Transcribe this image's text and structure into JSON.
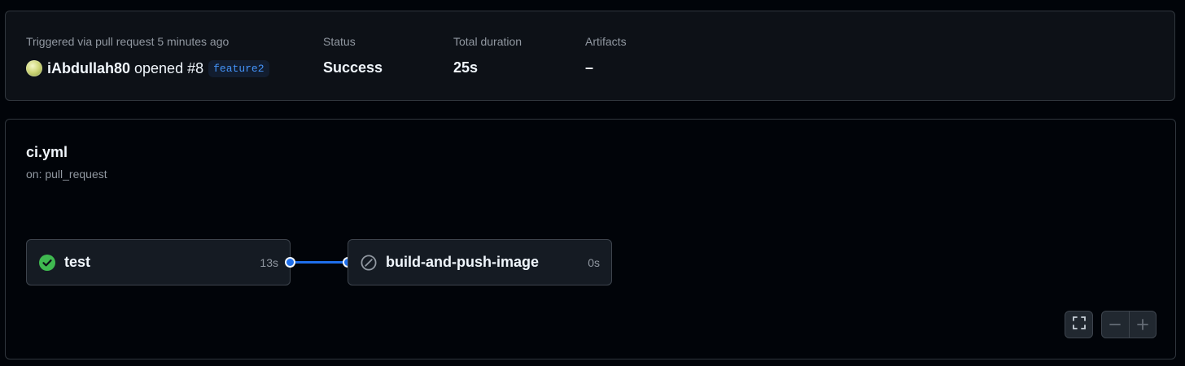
{
  "summary": {
    "trigger_label": "Triggered via pull request 5 minutes ago",
    "actor": "iAbdullah80",
    "action": "opened",
    "pr_number": "#8",
    "branch": "feature2",
    "status_label": "Status",
    "status_value": "Success",
    "duration_label": "Total duration",
    "duration_value": "25s",
    "artifacts_label": "Artifacts",
    "artifacts_value": "–"
  },
  "workflow": {
    "file": "ci.yml",
    "trigger": "on: pull_request",
    "jobs": [
      {
        "name": "test",
        "duration": "13s",
        "state": "success",
        "icon": "check-circle-icon"
      },
      {
        "name": "build-and-push-image",
        "duration": "0s",
        "state": "skipped",
        "icon": "skip-icon"
      }
    ]
  },
  "controls": {
    "fullscreen_icon": "fullscreen-icon",
    "zoom_out_icon": "zoom-out-icon",
    "zoom_in_icon": "zoom-in-icon"
  },
  "colors": {
    "success": "#3fb950",
    "accent": "#1f6feb",
    "branch_text": "#4493f8"
  }
}
